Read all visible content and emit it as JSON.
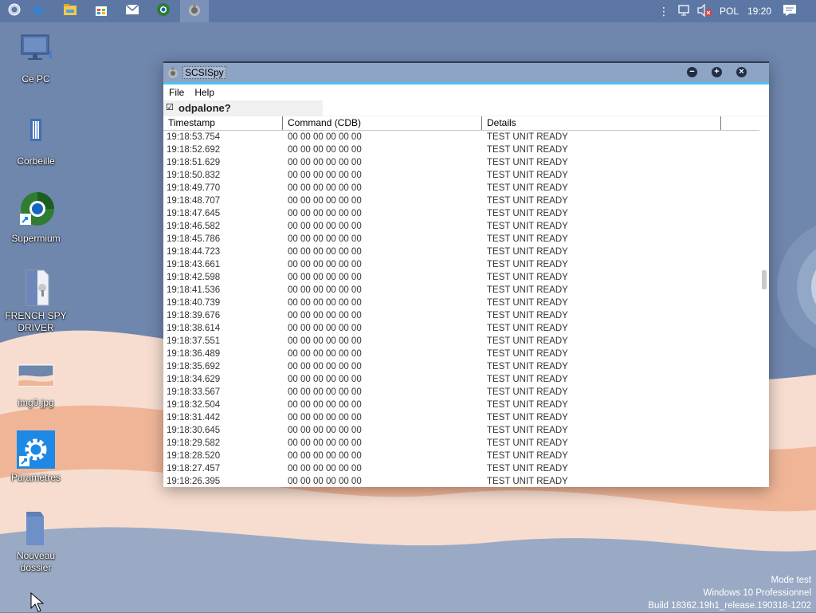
{
  "colors": {
    "taskbar": "#5d77a5",
    "accent": "#4cc3ee",
    "titlebar": "#8ea4c4",
    "wall_blue": "#6f86ad",
    "wall_peach": "#f0b597",
    "wall_cream": "#f6ddd0"
  },
  "taskbar": {
    "pinned": [
      {
        "name": "start-orb-icon"
      },
      {
        "name": "edge-icon"
      },
      {
        "name": "file-explorer-icon"
      },
      {
        "name": "store-icon"
      },
      {
        "name": "mail-icon"
      },
      {
        "name": "supermium-icon"
      },
      {
        "name": "scsispy-icon"
      }
    ],
    "tray": {
      "language": "POL",
      "time": "19:20"
    }
  },
  "desktop": {
    "icons": [
      {
        "label": "Ce PC",
        "icon": "computer-icon"
      },
      {
        "label": "Corbeille",
        "icon": "recycle-bin-icon"
      },
      {
        "label": "Supermium",
        "icon": "supermium-icon"
      },
      {
        "label": "FRENCH SPY DRIVER",
        "icon": "document-file-icon"
      },
      {
        "label": "img0.jpg",
        "icon": "image-file-icon"
      },
      {
        "label": "Paramètres",
        "icon": "settings-gear-icon"
      },
      {
        "label": "Nouveau dossier",
        "icon": "folder-icon"
      }
    ],
    "watermark": {
      "line1": "Mode test",
      "line2": "Windows 10 Professionnel",
      "line3": "Build 18362.19h1_release.190318-1202"
    }
  },
  "window": {
    "title": "SCSISpy",
    "menu": [
      "File",
      "Help"
    ],
    "option_label": "odpalone?",
    "option_checked": true,
    "columns": [
      "Timestamp",
      "Command (CDB)",
      "Details"
    ],
    "rows": [
      [
        "19:18:53.754",
        "00 00 00 00 00 00",
        "TEST UNIT READY"
      ],
      [
        "19:18:52.692",
        "00 00 00 00 00 00",
        "TEST UNIT READY"
      ],
      [
        "19:18:51.629",
        "00 00 00 00 00 00",
        "TEST UNIT READY"
      ],
      [
        "19:18:50.832",
        "00 00 00 00 00 00",
        "TEST UNIT READY"
      ],
      [
        "19:18:49.770",
        "00 00 00 00 00 00",
        "TEST UNIT READY"
      ],
      [
        "19:18:48.707",
        "00 00 00 00 00 00",
        "TEST UNIT READY"
      ],
      [
        "19:18:47.645",
        "00 00 00 00 00 00",
        "TEST UNIT READY"
      ],
      [
        "19:18:46.582",
        "00 00 00 00 00 00",
        "TEST UNIT READY"
      ],
      [
        "19:18:45.786",
        "00 00 00 00 00 00",
        "TEST UNIT READY"
      ],
      [
        "19:18:44.723",
        "00 00 00 00 00 00",
        "TEST UNIT READY"
      ],
      [
        "19:18:43.661",
        "00 00 00 00 00 00",
        "TEST UNIT READY"
      ],
      [
        "19:18:42.598",
        "00 00 00 00 00 00",
        "TEST UNIT READY"
      ],
      [
        "19:18:41.536",
        "00 00 00 00 00 00",
        "TEST UNIT READY"
      ],
      [
        "19:18:40.739",
        "00 00 00 00 00 00",
        "TEST UNIT READY"
      ],
      [
        "19:18:39.676",
        "00 00 00 00 00 00",
        "TEST UNIT READY"
      ],
      [
        "19:18:38.614",
        "00 00 00 00 00 00",
        "TEST UNIT READY"
      ],
      [
        "19:18:37.551",
        "00 00 00 00 00 00",
        "TEST UNIT READY"
      ],
      [
        "19:18:36.489",
        "00 00 00 00 00 00",
        "TEST UNIT READY"
      ],
      [
        "19:18:35.692",
        "00 00 00 00 00 00",
        "TEST UNIT READY"
      ],
      [
        "19:18:34.629",
        "00 00 00 00 00 00",
        "TEST UNIT READY"
      ],
      [
        "19:18:33.567",
        "00 00 00 00 00 00",
        "TEST UNIT READY"
      ],
      [
        "19:18:32.504",
        "00 00 00 00 00 00",
        "TEST UNIT READY"
      ],
      [
        "19:18:31.442",
        "00 00 00 00 00 00",
        "TEST UNIT READY"
      ],
      [
        "19:18:30.645",
        "00 00 00 00 00 00",
        "TEST UNIT READY"
      ],
      [
        "19:18:29.582",
        "00 00 00 00 00 00",
        "TEST UNIT READY"
      ],
      [
        "19:18:28.520",
        "00 00 00 00 00 00",
        "TEST UNIT READY"
      ],
      [
        "19:18:27.457",
        "00 00 00 00 00 00",
        "TEST UNIT READY"
      ],
      [
        "19:18:26.395",
        "00 00 00 00 00 00",
        "TEST UNIT READY"
      ]
    ]
  }
}
